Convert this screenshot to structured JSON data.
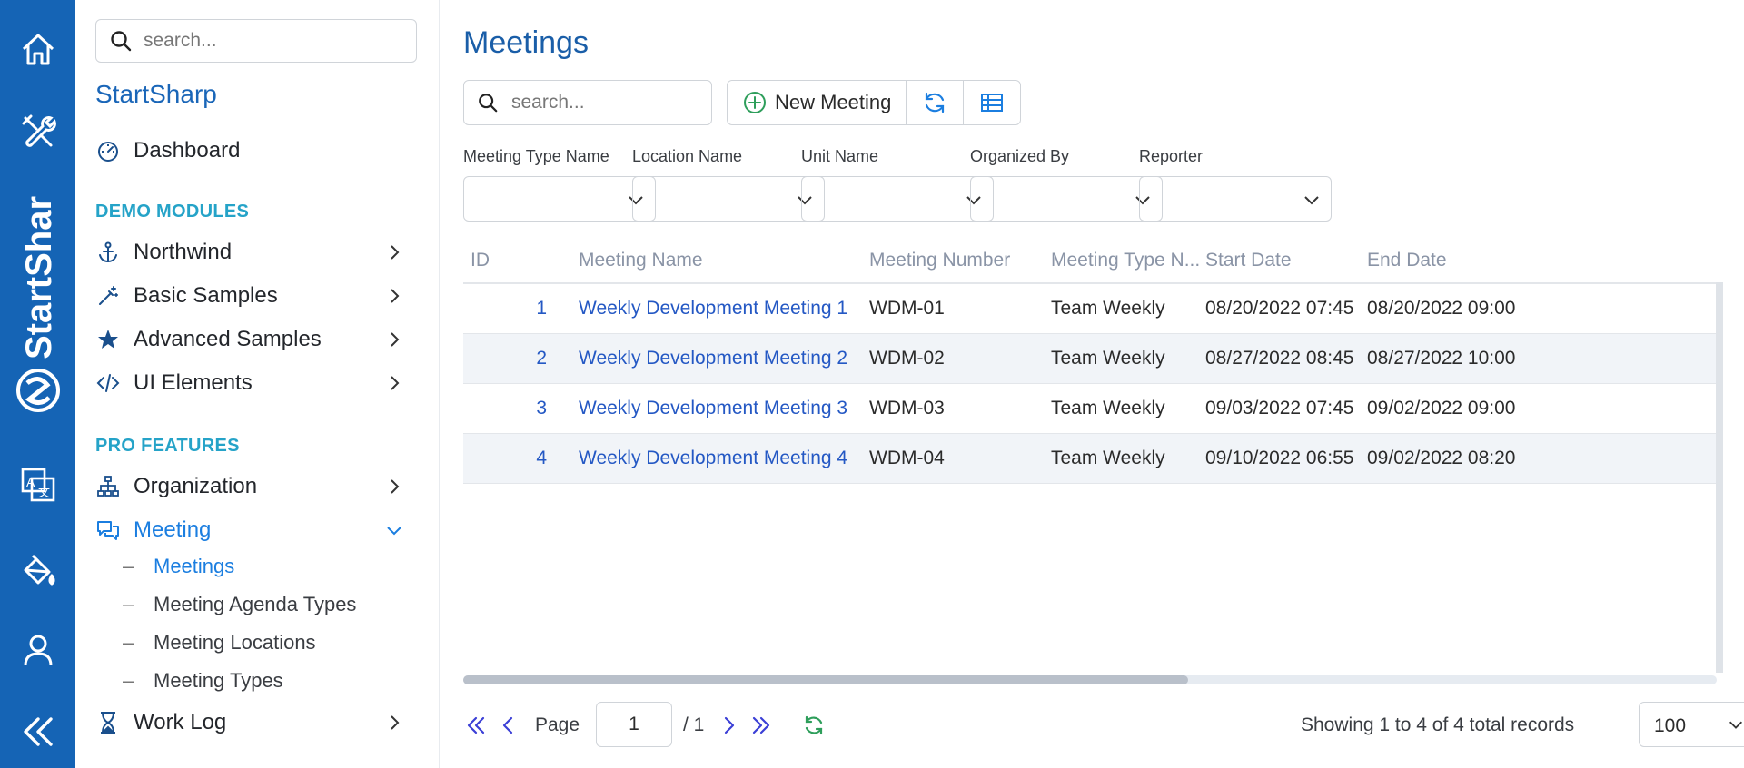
{
  "rail": {
    "brand": "StartShar",
    "icons": [
      "home-icon",
      "tools-icon",
      "translate-icon",
      "paint-bucket-icon",
      "user-icon",
      "collapse-icon"
    ]
  },
  "sidebar": {
    "search_placeholder": "search...",
    "brand_title": "StartSharp",
    "dashboard": "Dashboard",
    "section_demo": "DEMO MODULES",
    "northwind": "Northwind",
    "basic_samples": "Basic Samples",
    "advanced_samples": "Advanced Samples",
    "ui_elements": "UI Elements",
    "section_pro": "PRO FEATURES",
    "organization": "Organization",
    "meeting": "Meeting",
    "meeting_children": [
      "Meetings",
      "Meeting Agenda Types",
      "Meeting Locations",
      "Meeting Types"
    ],
    "work_log": "Work Log"
  },
  "main": {
    "title": "Meetings",
    "search_placeholder": "search...",
    "new_button": "New Meeting",
    "filters": [
      "Meeting Type Name",
      "Location Name",
      "Unit Name",
      "Organized By",
      "Reporter"
    ],
    "columns": [
      "ID",
      "Meeting Name",
      "Meeting Number",
      "Meeting Type N...",
      "Start Date",
      "End Date"
    ],
    "rows": [
      {
        "id": "1",
        "name": "Weekly Development Meeting 1",
        "number": "WDM-01",
        "type": "Team Weekly",
        "start": "08/20/2022 07:45",
        "end": "08/20/2022 09:00"
      },
      {
        "id": "2",
        "name": "Weekly Development Meeting 2",
        "number": "WDM-02",
        "type": "Team Weekly",
        "start": "08/27/2022 08:45",
        "end": "08/27/2022 10:00"
      },
      {
        "id": "3",
        "name": "Weekly Development Meeting 3",
        "number": "WDM-03",
        "type": "Team Weekly",
        "start": "09/03/2022 07:45",
        "end": "09/02/2022 09:00"
      },
      {
        "id": "4",
        "name": "Weekly Development Meeting 4",
        "number": "WDM-04",
        "type": "Team Weekly",
        "start": "09/10/2022 06:55",
        "end": "09/02/2022 08:20"
      }
    ]
  },
  "pager": {
    "page_label": "Page",
    "page_value": "1",
    "of_total": "/ 1",
    "status": "Showing 1 to 4 of 4 total records",
    "page_size": "100"
  },
  "colors": {
    "rail": "#1564b5",
    "accent": "#1b7ee0",
    "link": "#2458c4",
    "section": "#25a3c8",
    "green": "#2e9e5b"
  }
}
